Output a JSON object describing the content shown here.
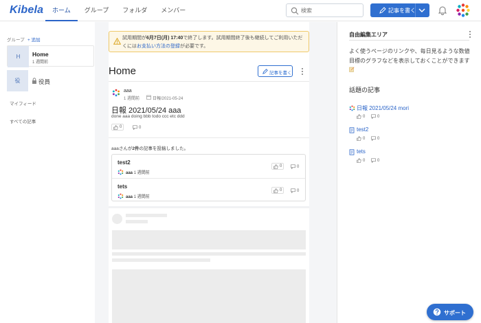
{
  "header": {
    "logo": "Kibela",
    "nav": [
      "ホーム",
      "グループ",
      "フォルダ",
      "メンバー"
    ],
    "search_placeholder": "検索",
    "write_button": "記事を書く"
  },
  "sidebar": {
    "group_label": "グループ",
    "add_label": "+ 追加",
    "groups": [
      {
        "initial": "H",
        "name": "Home",
        "sub": "1 週間前"
      },
      {
        "initial": "役",
        "name": "役員"
      }
    ],
    "links": [
      "マイフィード",
      "すべての記事"
    ]
  },
  "notice": {
    "part1": "試用期間が",
    "bold": "6月7日(月) 17:40",
    "part2": "で終了します。試用期間終了後も継続してご利用いただくには",
    "link": "お支払い方法の登録",
    "part3": "が必要です。"
  },
  "main": {
    "title": "Home",
    "write_button": "記事を書く",
    "post": {
      "author": "aaa",
      "ago": "1 週間前",
      "date": "日報/2021-05-24",
      "title": "日報 2021/05/24 aaa",
      "body": "done aaa doing bbb todo ccc etc ddd",
      "likes": "0",
      "comments": "0"
    },
    "activity": {
      "who": "aaa",
      "mid": "さんが",
      "count": "2件",
      "tail": "の記事を投稿しました。"
    },
    "articles": [
      {
        "title": "test2",
        "author": "aaa",
        "ago": "1 週間前",
        "likes": "0",
        "comments": "0"
      },
      {
        "title": "tets",
        "author": "aaa",
        "ago": "1 週間前",
        "likes": "0",
        "comments": "0"
      }
    ]
  },
  "right": {
    "free_title": "自由編集エリア",
    "free_text": "よく使うページのリンクや、毎日見るような数値目標のグラフなどを表示しておくことができます",
    "topics_title": "話題の記事",
    "topics": [
      {
        "title": "日報 2021/05/24 mori",
        "likes": "0",
        "comments": "0"
      },
      {
        "title": "test2",
        "likes": "0",
        "comments": "0"
      },
      {
        "title": "tets",
        "likes": "0",
        "comments": "0"
      }
    ]
  },
  "support": "サポート",
  "colors": {
    "accent": "#2f6fd0",
    "notice_bg": "#fdf7e6",
    "notice_border": "#efc96a"
  }
}
